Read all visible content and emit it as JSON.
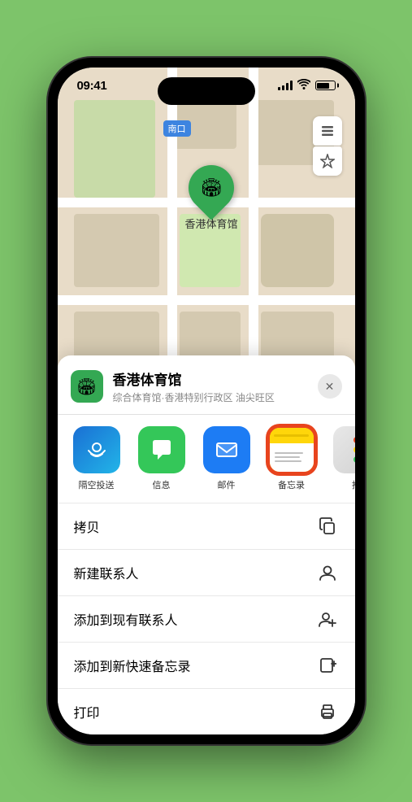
{
  "status_bar": {
    "time": "09:41",
    "location_arrow": "▲"
  },
  "map": {
    "label": "南口",
    "pin_label": "香港体育馆"
  },
  "sheet": {
    "title": "香港体育馆",
    "subtitle": "综合体育馆·香港特别行政区 油尖旺区",
    "close_label": "✕"
  },
  "share_items": [
    {
      "id": "airdrop",
      "label": "隔空投送"
    },
    {
      "id": "messages",
      "label": "信息"
    },
    {
      "id": "mail",
      "label": "邮件"
    },
    {
      "id": "notes",
      "label": "备忘录"
    },
    {
      "id": "more",
      "label": "推"
    }
  ],
  "actions": [
    {
      "id": "copy",
      "label": "拷贝",
      "icon": "copy"
    },
    {
      "id": "new-contact",
      "label": "新建联系人",
      "icon": "person"
    },
    {
      "id": "add-contact",
      "label": "添加到现有联系人",
      "icon": "person-add"
    },
    {
      "id": "quick-note",
      "label": "添加到新快速备忘录",
      "icon": "note"
    },
    {
      "id": "print",
      "label": "打印",
      "icon": "print"
    }
  ]
}
